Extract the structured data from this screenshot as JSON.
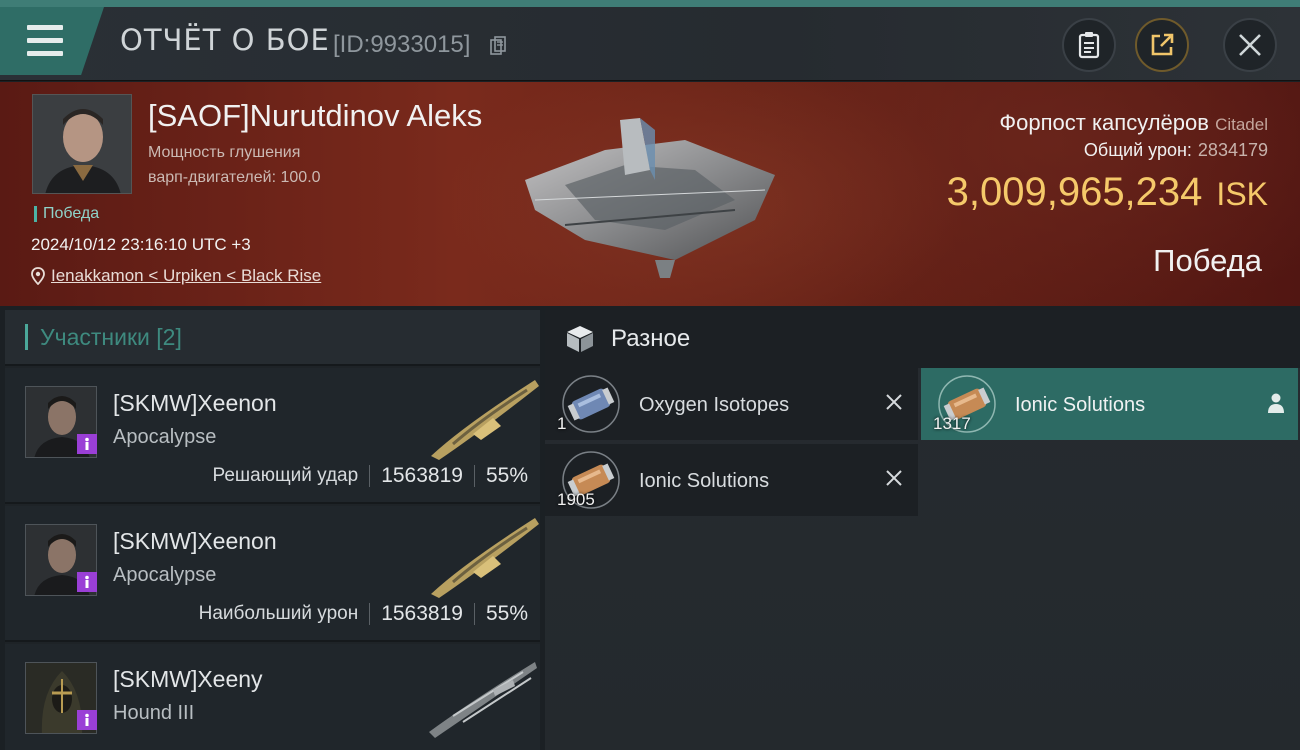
{
  "header": {
    "title": "ОТЧЁТ О БОЕ",
    "report_id": "[ID:9933015]",
    "menu_icon": "hamburger-icon",
    "buttons": [
      "clipboard-icon",
      "share-icon",
      "close-icon"
    ]
  },
  "victim": {
    "pilot_name": "[SAOF]Nurutdinov Aleks",
    "stat_line1": "Мощность глушения",
    "stat_line2": "варп-двигателей: 100.0",
    "victory_tag": "Победа",
    "datetime": "2024/10/12 23:16:10 UTC +3",
    "location": "Ienakkamon < Urpiken < Black Rise",
    "ship_name": "Форпост капсулёров",
    "ship_class": "Citadel",
    "total_damage_label": "Общий урон:",
    "total_damage_value": "2834179",
    "isk_value": "3,009,965,234",
    "isk_unit": "ISK",
    "result": "Победа"
  },
  "participants": {
    "title": "Участники [2]",
    "rows": [
      {
        "name": "[SKMW]Xeenon",
        "ship": "Apocalypse",
        "label": "Решающий удар",
        "damage": "1563819",
        "percent": "55%"
      },
      {
        "name": "[SKMW]Xeenon",
        "ship": "Apocalypse",
        "label": "Наибольший урон",
        "damage": "1563819",
        "percent": "55%"
      },
      {
        "name": "[SKMW]Xeeny",
        "ship": "Hound III"
      }
    ]
  },
  "misc": {
    "title": "Разное",
    "items": [
      {
        "name": "Oxygen Isotopes",
        "qty": "1",
        "status": "destroyed"
      },
      {
        "name": "Ionic Solutions",
        "qty": "1317",
        "status": "dropped"
      },
      {
        "name": "Ionic Solutions",
        "qty": "1905",
        "status": "destroyed"
      }
    ]
  },
  "colors": {
    "accent_teal": "#2f6d66",
    "isk_gold": "#f5c96a",
    "banner_red": "#6a2418",
    "badge_purple": "#9a3fd6"
  }
}
